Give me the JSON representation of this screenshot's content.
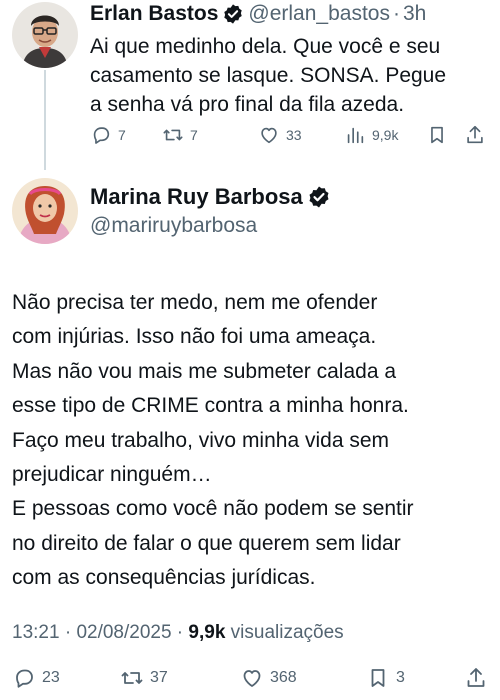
{
  "tweet1": {
    "name": "Erlan Bastos",
    "handle": "@erlan_bastos",
    "separator": "·",
    "time": "3h",
    "text_lines": [
      "Ai que medinho dela. Que você e seu",
      "casamento se lasque. SONSA. Pegue",
      "a senha vá pro final da fila azeda."
    ],
    "actions": {
      "replies": "7",
      "reposts": "7",
      "likes": "33",
      "views": "9,9k"
    }
  },
  "tweet2": {
    "name": "Marina Ruy Barbosa",
    "handle": "@mariruybarbosa",
    "text_lines": [
      "Não precisa ter medo, nem me ofender",
      "com injúrias. Isso não foi uma ameaça.",
      "Mas não vou mais me submeter calada a",
      "esse tipo de CRIME contra a minha honra.",
      "Faço meu trabalho, vivo minha vida sem",
      "prejudicar ninguém…",
      "E pessoas como você não podem se sentir",
      "no direito de falar o que querem sem lidar",
      "com as consequências jurídicas."
    ],
    "meta": {
      "time": "13:21",
      "sep1": " · ",
      "date": "02/08/2025",
      "sep2": " · ",
      "views": "9,9k",
      "views_label": " visualizações"
    },
    "actions": {
      "replies": "23",
      "reposts": "37",
      "likes": "368",
      "bookmarks": "3"
    }
  },
  "colors": {
    "text": "#0f1419",
    "muted": "#536471",
    "verified": "#1d9bf0",
    "thread_line": "#cfd9de"
  },
  "icons": [
    "reply-icon",
    "repost-icon",
    "like-icon",
    "views-icon",
    "bookmark-icon",
    "share-icon",
    "verified-badge-icon"
  ]
}
